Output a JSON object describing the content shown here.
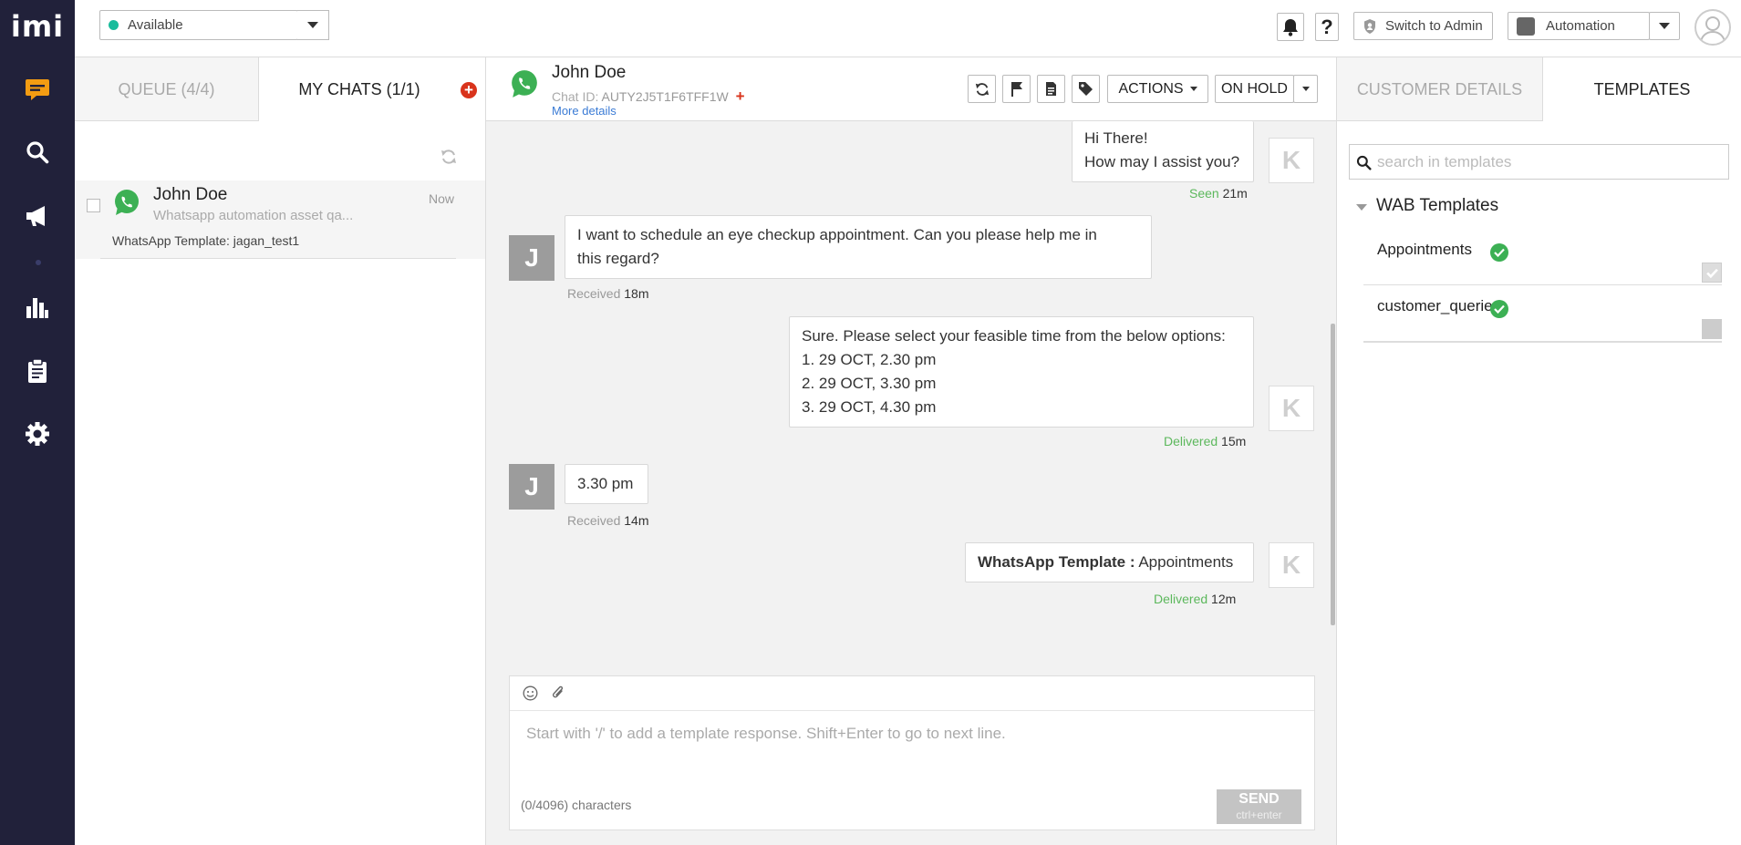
{
  "app": {
    "logo": "imi"
  },
  "nav": {
    "items": [
      "chat-icon",
      "search-icon",
      "megaphone-icon",
      "analytics-icon",
      "clipboard-icon",
      "settings-icon"
    ]
  },
  "header": {
    "status": "Available",
    "switch_admin": "Switch to Admin",
    "workspace": "Automation",
    "help": "?"
  },
  "list": {
    "tabs": {
      "queue": "QUEUE (4/4)",
      "my_chats": "MY CHATS (1/1)"
    },
    "items": [
      {
        "name": "John Doe",
        "time": "Now",
        "preview": "Whatsapp automation asset qa...",
        "template": "WhatsApp Template: jagan_test1"
      }
    ]
  },
  "chat": {
    "contact_name": "John Doe",
    "chat_id_label": "Chat ID:",
    "chat_id": "AUTY2J5T1F6TFF1W",
    "more_details": "More details",
    "actions": "ACTIONS",
    "on_hold": "ON HOLD",
    "messages": [
      {
        "from": "agent",
        "avatar": "K",
        "lines": [
          "Hi There!",
          "How may I assist you?"
        ],
        "status": "Seen",
        "time": "21m"
      },
      {
        "from": "customer",
        "avatar": "J",
        "lines": [
          "I want to schedule an eye checkup appointment. Can you please help me in",
          "this regard?"
        ],
        "status": "Received",
        "time": "18m"
      },
      {
        "from": "agent",
        "avatar": "K",
        "lines": [
          "Sure. Please select your feasible time from the below options:",
          "1. 29 OCT, 2.30 pm",
          "2. 29 OCT, 3.30 pm",
          "3. 29 OCT, 4.30 pm"
        ],
        "status": "Delivered",
        "time": "15m"
      },
      {
        "from": "customer",
        "avatar": "J",
        "lines": [
          "3.30 pm"
        ],
        "status": "Received",
        "time": "14m"
      },
      {
        "from": "agent",
        "avatar": "K",
        "template_label": "WhatsApp Template :",
        "template_name": "Appointments",
        "status": "Delivered",
        "time": "12m"
      }
    ],
    "composer": {
      "placeholder": "Start with '/' to add a template response. Shift+Enter to go to next line.",
      "char_count": "(0/4096) characters",
      "send": "SEND",
      "send_hint": "ctrl+enter"
    }
  },
  "right": {
    "tabs": {
      "customer_details": "CUSTOMER DETAILS",
      "templates": "TEMPLATES"
    },
    "search_placeholder": "search in templates",
    "group": "WAB Templates",
    "templates": [
      {
        "name": "Appointments",
        "checked": true
      },
      {
        "name": "customer_queries",
        "checked": false
      }
    ]
  },
  "colors": {
    "nav_bg": "#21213a",
    "accent_orange": "#f39c12",
    "whatsapp_green": "#3cb054",
    "status_teal": "#1abc9c",
    "add_red": "#d9341c"
  }
}
